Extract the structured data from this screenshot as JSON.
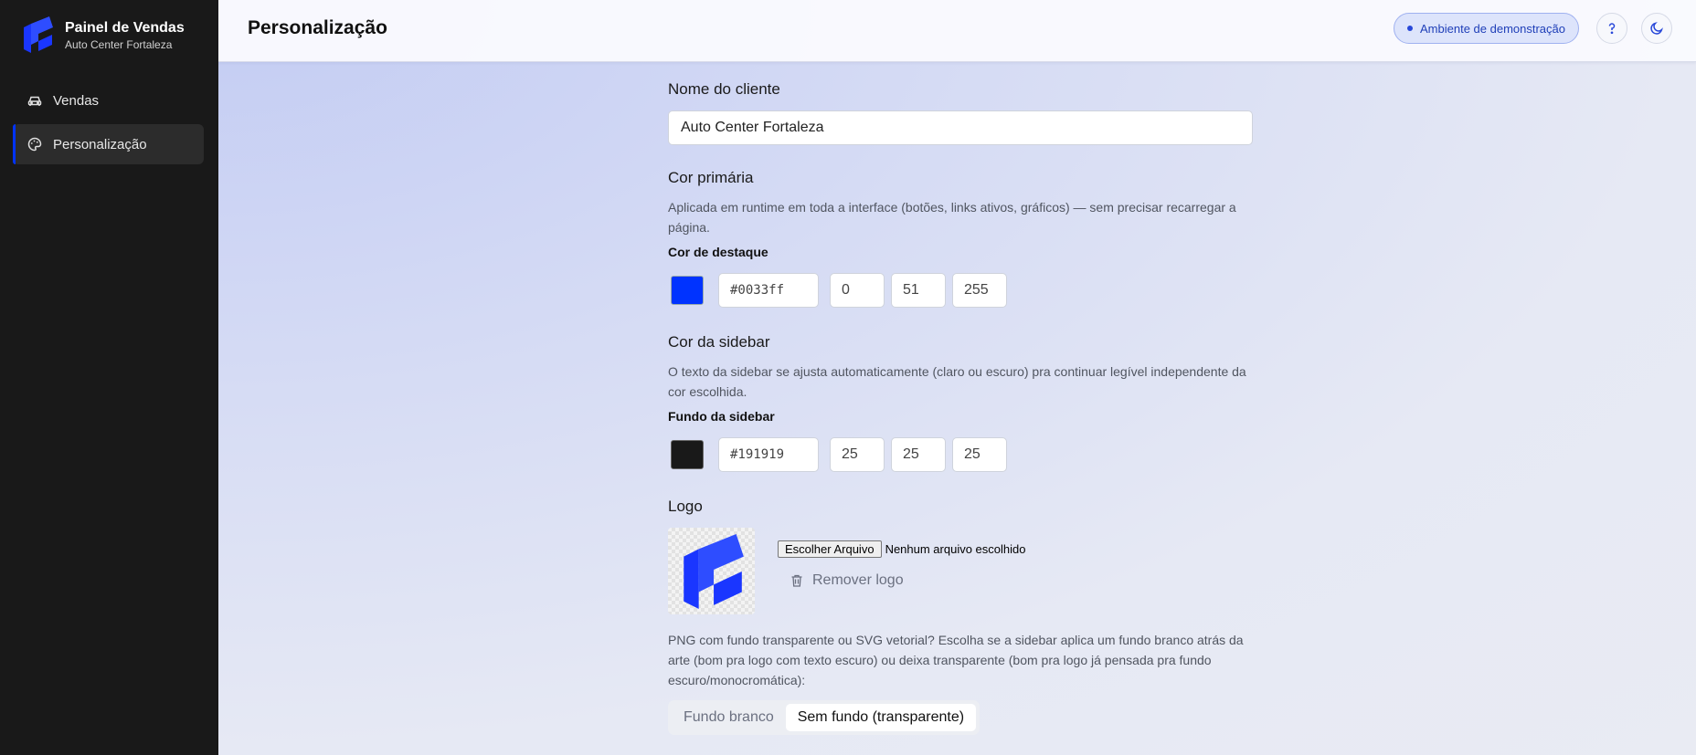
{
  "sidebar": {
    "brand_title": "Painel de Vendas",
    "brand_subtitle": "Auto Center Fortaleza",
    "background": "#191919",
    "items": [
      {
        "label": "Vendas",
        "icon": "car-icon",
        "active": false
      },
      {
        "label": "Personalização",
        "icon": "palette-icon",
        "active": true
      }
    ]
  },
  "header": {
    "title": "Personalização",
    "demo_badge": "Ambiente de demonstração",
    "help_icon": "question-icon",
    "theme_icon": "moon-icon"
  },
  "form": {
    "client": {
      "title": "Nome do cliente",
      "value": "Auto Center Fortaleza"
    },
    "primary": {
      "title": "Cor primária",
      "description": "Aplicada em runtime em toda a interface (botões, links ativos, gráficos) — sem precisar recarregar a página.",
      "label": "Cor de destaque",
      "hex": "#0033ff",
      "r": "0",
      "g": "51",
      "b": "255"
    },
    "sidebar_color": {
      "title": "Cor da sidebar",
      "description": "O texto da sidebar se ajusta automaticamente (claro ou escuro) pra continuar legível independente da cor escolhida.",
      "label": "Fundo da sidebar",
      "hex": "#191919",
      "r": "25",
      "g": "25",
      "b": "25"
    },
    "logo": {
      "title": "Logo",
      "file_button": "Escolher Arquivo",
      "file_status": "Nenhum arquivo escolhido",
      "remove_label": "Remover logo",
      "description": "PNG com fundo transparente ou SVG vetorial? Escolha se a sidebar aplica um fundo branco atrás da arte (bom pra logo com texto escuro) ou deixa transparente (bom pra logo já pensada pra fundo escuro/monocromática):",
      "options": [
        {
          "label": "Fundo branco",
          "selected": false
        },
        {
          "label": "Sem fundo (transparente)",
          "selected": true
        }
      ]
    }
  },
  "colors": {
    "accent": "#0033ff",
    "sidebar_bg": "#191919"
  }
}
